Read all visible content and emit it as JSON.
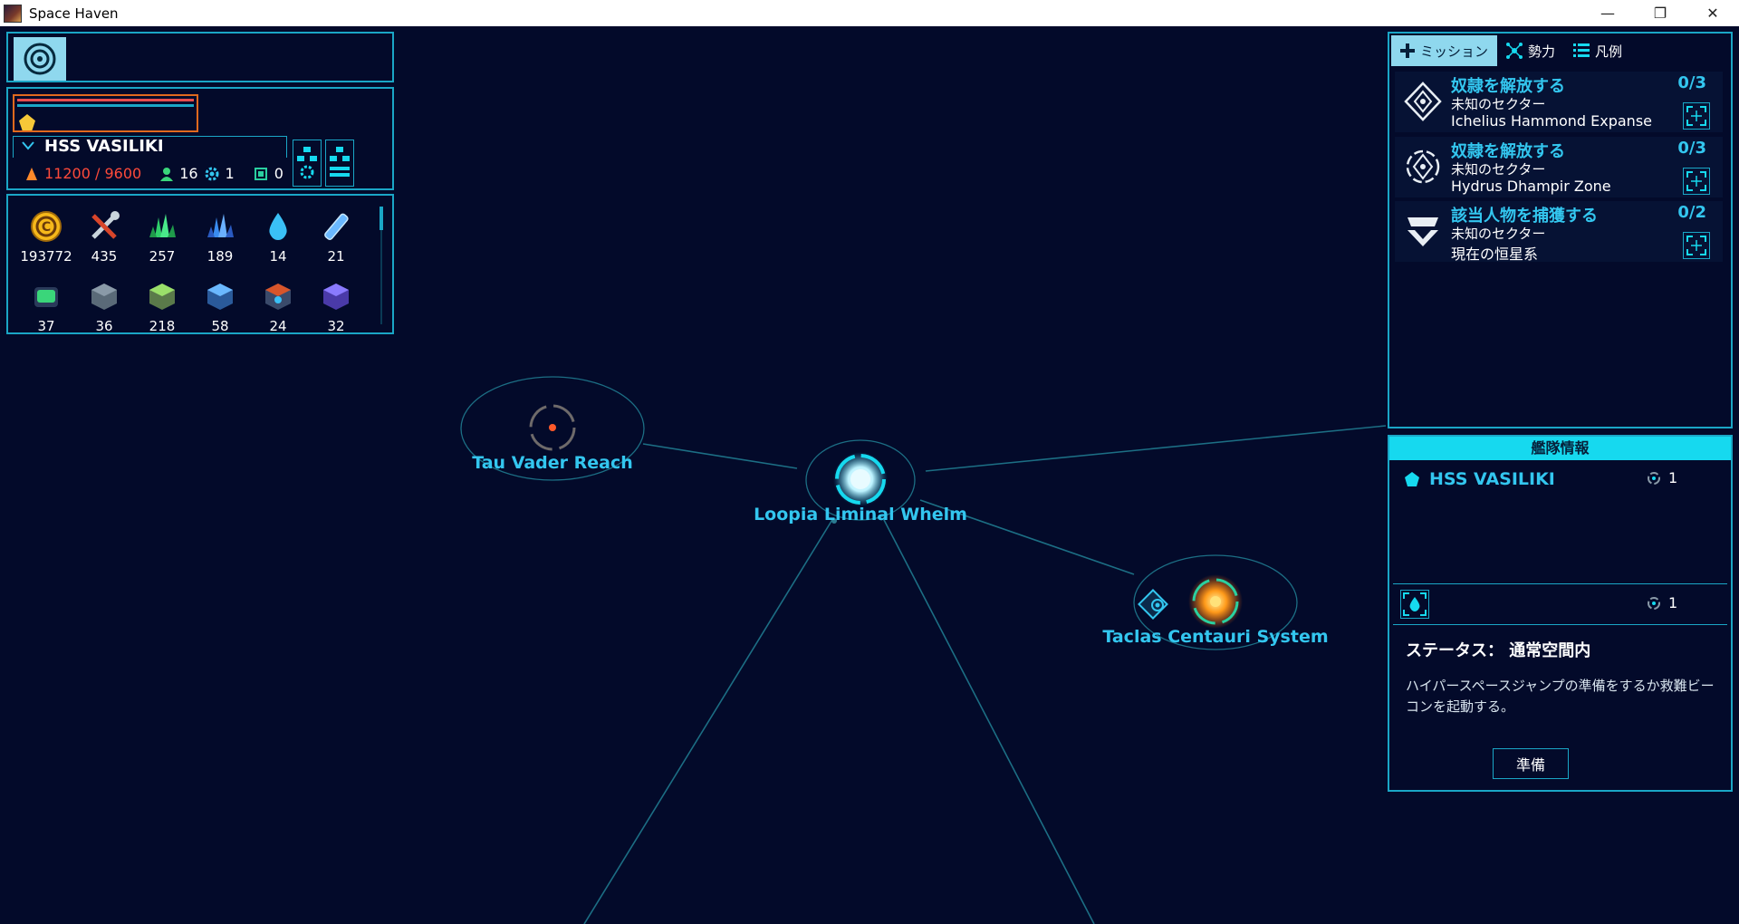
{
  "window": {
    "title": "Space Haven",
    "minimize": "—",
    "restore": "❐",
    "close": "✕"
  },
  "ship": {
    "name": "HSS VASILIKI",
    "energy": "11200 / 9600",
    "crew": "16",
    "modules": "1",
    "chips": "0"
  },
  "resources": [
    {
      "icon": "credits-icon",
      "value": "193772"
    },
    {
      "icon": "tools-icon",
      "value": "435"
    },
    {
      "icon": "green-crystal-icon",
      "value": "257"
    },
    {
      "icon": "blue-crystal-icon",
      "value": "189"
    },
    {
      "icon": "water-drop-icon",
      "value": "14"
    },
    {
      "icon": "energy-rod-icon",
      "value": "21"
    },
    {
      "icon": "bio-cube-icon",
      "value": "37"
    },
    {
      "icon": "metal-block-icon",
      "value": "36"
    },
    {
      "icon": "fabric-block-icon",
      "value": "218"
    },
    {
      "icon": "tech-cube-icon",
      "value": "58"
    },
    {
      "icon": "reactor-cube-icon",
      "value": "24"
    },
    {
      "icon": "infra-cube-icon",
      "value": "32"
    }
  ],
  "tabs": [
    {
      "label": "ミッション",
      "icon": "plus-cross-icon"
    },
    {
      "label": "勢力",
      "icon": "network-icon"
    },
    {
      "label": "凡例",
      "icon": "list-icon"
    }
  ],
  "missions": [
    {
      "title": "奴隷を解放する",
      "progress": "0/3",
      "sub": "未知のセクター",
      "location": "Ichelius Hammond Expanse"
    },
    {
      "title": "奴隷を解放する",
      "progress": "0/3",
      "sub": "未知のセクター",
      "location": "Hydrus Dhampir Zone"
    },
    {
      "title": "該当人物を捕獲する",
      "progress": "0/2",
      "sub": "未知のセクター",
      "location": "現在の恒星系"
    }
  ],
  "fleet": {
    "header": "艦隊情報",
    "ship_name": "HSS VASILIKI",
    "ship_jumps": "1",
    "scout_jumps": "1",
    "status": "ステータス： 通常空間内",
    "description": "ハイパースペースジャンプの準備をするか救難ビーコンを起動する。",
    "prepare_label": "準備"
  },
  "systems": [
    {
      "name": "Tau Vader Reach"
    },
    {
      "name": "Loopia Liminal Whelm"
    },
    {
      "name": "Taclas Centauri System"
    }
  ],
  "colors": {
    "accent": "#1aa6c6",
    "label": "#33c6ef",
    "alert": "#ff4a3a",
    "background": "#030a2a"
  }
}
